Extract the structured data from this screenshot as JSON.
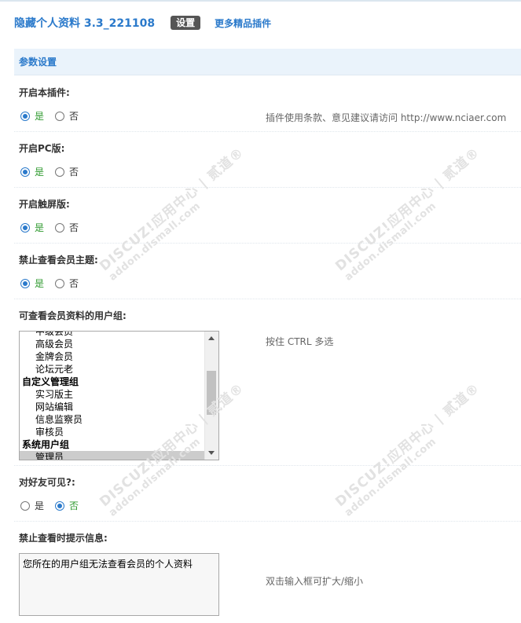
{
  "header": {
    "title": "隐藏个人资料 3.3_221108",
    "settings_badge": "设置",
    "more_link": "更多精品插件"
  },
  "section": {
    "title": "参数设置"
  },
  "yes_label": "是",
  "no_label": "否",
  "settings": [
    {
      "label": "开启本插件:",
      "value": "yes",
      "hint": "插件使用条款、意见建议请访问 http://www.nciaer.com"
    },
    {
      "label": "开启PC版:",
      "value": "yes"
    },
    {
      "label": "开启触屏版:",
      "value": "yes"
    },
    {
      "label": "禁止查看会员主题:",
      "value": "yes"
    }
  ],
  "usergroups": {
    "label": "可查看会员资料的用户组:",
    "hint": "按住 CTRL 多选",
    "items": [
      {
        "text": "中级会员",
        "type": "item"
      },
      {
        "text": "高级会员",
        "type": "item"
      },
      {
        "text": "金牌会员",
        "type": "item"
      },
      {
        "text": "论坛元老",
        "type": "item"
      },
      {
        "text": "自定义管理组",
        "type": "group"
      },
      {
        "text": "实习版主",
        "type": "item"
      },
      {
        "text": "网站编辑",
        "type": "item"
      },
      {
        "text": "信息监察员",
        "type": "item"
      },
      {
        "text": "审核员",
        "type": "item"
      },
      {
        "text": "系统用户组",
        "type": "group"
      },
      {
        "text": "管理员",
        "type": "item",
        "selected": true
      }
    ]
  },
  "friends_visible": {
    "label": "对好友可见?:",
    "value": "no"
  },
  "message": {
    "label": "禁止查看时提示信息:",
    "value": "您所在的用户组无法查看会员的个人资料",
    "hint": "双击输入框可扩大/缩小"
  },
  "watermark": {
    "line1": "DISCUZ!应用中心 | 贰道®",
    "line2": "addon.dismall.com"
  }
}
